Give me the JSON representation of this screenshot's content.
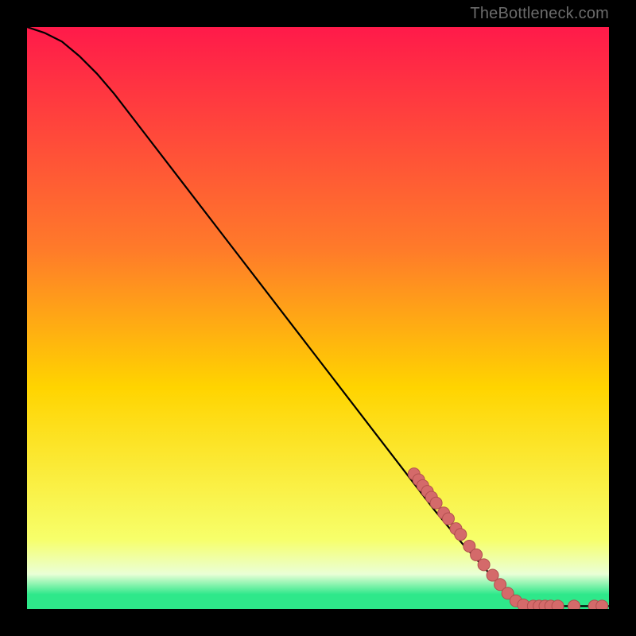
{
  "watermark": "TheBottleneck.com",
  "colors": {
    "gradient_top": "#ff1a4a",
    "gradient_upper_mid": "#ff7a2a",
    "gradient_mid": "#ffd400",
    "gradient_lower_mid": "#f7ff6a",
    "gradient_band_pale": "#eaffd6",
    "gradient_band_green": "#2ee88a",
    "curve": "#000000",
    "marker_fill": "#d46a6a",
    "marker_stroke": "#b24f4f"
  },
  "chart_data": {
    "type": "line",
    "x": [
      0.0,
      0.03,
      0.06,
      0.09,
      0.12,
      0.15,
      0.2,
      0.25,
      0.3,
      0.35,
      0.4,
      0.45,
      0.5,
      0.55,
      0.6,
      0.65,
      0.7,
      0.75,
      0.8,
      0.84,
      0.86,
      0.87,
      0.9,
      0.93,
      0.96,
      1.0
    ],
    "values": [
      1.0,
      0.99,
      0.975,
      0.95,
      0.92,
      0.885,
      0.82,
      0.755,
      0.69,
      0.625,
      0.56,
      0.495,
      0.43,
      0.365,
      0.3,
      0.235,
      0.17,
      0.11,
      0.055,
      0.02,
      0.01,
      0.005,
      0.005,
      0.005,
      0.005,
      0.005
    ],
    "xlabel": "",
    "ylabel": "",
    "title": "",
    "xlim": [
      0,
      1
    ],
    "ylim": [
      0,
      1
    ],
    "markers": [
      {
        "x": 0.665,
        "y": 0.232
      },
      {
        "x": 0.673,
        "y": 0.222
      },
      {
        "x": 0.68,
        "y": 0.212
      },
      {
        "x": 0.688,
        "y": 0.202
      },
      {
        "x": 0.695,
        "y": 0.192
      },
      {
        "x": 0.703,
        "y": 0.182
      },
      {
        "x": 0.716,
        "y": 0.165
      },
      {
        "x": 0.724,
        "y": 0.155
      },
      {
        "x": 0.737,
        "y": 0.138
      },
      {
        "x": 0.745,
        "y": 0.128
      },
      {
        "x": 0.76,
        "y": 0.108
      },
      {
        "x": 0.772,
        "y": 0.093
      },
      {
        "x": 0.785,
        "y": 0.076
      },
      {
        "x": 0.8,
        "y": 0.058
      },
      {
        "x": 0.813,
        "y": 0.042
      },
      {
        "x": 0.826,
        "y": 0.027
      },
      {
        "x": 0.84,
        "y": 0.014
      },
      {
        "x": 0.853,
        "y": 0.007
      },
      {
        "x": 0.87,
        "y": 0.005
      },
      {
        "x": 0.88,
        "y": 0.005
      },
      {
        "x": 0.89,
        "y": 0.005
      },
      {
        "x": 0.9,
        "y": 0.005
      },
      {
        "x": 0.912,
        "y": 0.005
      },
      {
        "x": 0.94,
        "y": 0.005
      },
      {
        "x": 0.975,
        "y": 0.005
      },
      {
        "x": 0.988,
        "y": 0.005
      }
    ],
    "green_band_y_range": [
      0.0,
      0.025
    ],
    "pale_band_y_range": [
      0.025,
      0.085
    ]
  }
}
